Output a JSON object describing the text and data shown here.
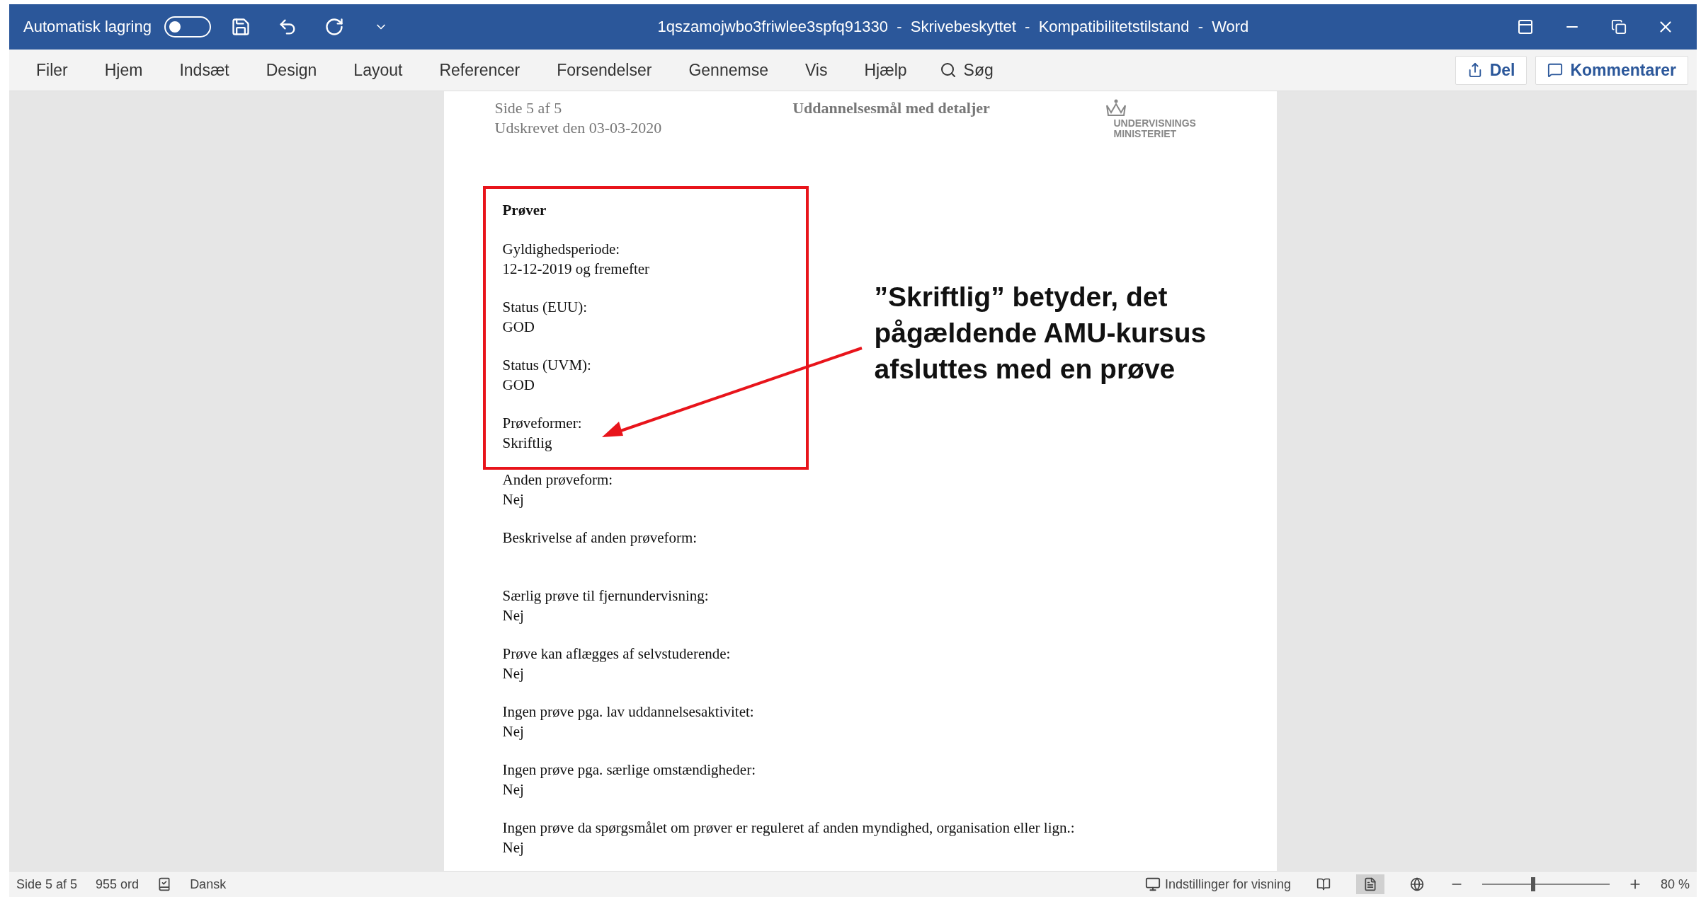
{
  "title_bar": {
    "autosave_label": "Automatisk lagring",
    "autosave_on": false,
    "title": "1qszamojwbo3friwlee3spfq91330  -  Skrivebeskyttet  -  Kompatibilitetstilstand  -  Word"
  },
  "ribbon": {
    "tabs": [
      "Filer",
      "Hjem",
      "Indsæt",
      "Design",
      "Layout",
      "Referencer",
      "Forsendelser",
      "Gennemse",
      "Vis",
      "Hjælp"
    ],
    "search": "Søg",
    "share": "Del",
    "comments": "Kommentarer"
  },
  "page": {
    "header": {
      "page_label": "Side  5  af  5",
      "printed": "Udskrevet den 03-03-2020",
      "heading": "Uddannelsesmål med detaljer",
      "logo_lines": [
        "UNDERVISNINGS",
        "MINISTERIET"
      ]
    },
    "highlight_box": {
      "title": "Prøver",
      "fields": [
        {
          "label": "Gyldighedsperiode:",
          "value": "12-12-2019 og fremefter"
        },
        {
          "label": "Status (EUU):",
          "value": "GOD"
        },
        {
          "label": "Status (UVM):",
          "value": "GOD"
        },
        {
          "label": "Prøveformer:",
          "value": "Skriftlig"
        }
      ]
    },
    "fields": [
      {
        "label": "Anden prøveform:",
        "value": "Nej"
      },
      {
        "label": "Beskrivelse af anden prøveform:"
      },
      {
        "label": "Særlig prøve til fjernundervisning:",
        "value": "Nej"
      },
      {
        "label": "Prøve kan aflægges af selvstuderende:",
        "value": "Nej"
      },
      {
        "label": "Ingen prøve pga. lav uddannelsesaktivitet:",
        "value": "Nej"
      },
      {
        "label": "Ingen prøve pga. særlige omstændigheder:",
        "value": "Nej"
      },
      {
        "label": "Ingen prøve da spørgsmålet om prøver er reguleret af anden myndighed, organisation eller lign.:",
        "value": "Nej"
      }
    ]
  },
  "annotation": {
    "lines": [
      "”Skriftlig” betyder, det",
      "pågældende AMU-kursus",
      "afsluttes med en prøve"
    ]
  },
  "status_bar": {
    "page": "Side 5 af 5",
    "words": "955 ord",
    "language": "Dansk",
    "display_settings": "Indstillinger for visning",
    "views": [
      {
        "kind": "read",
        "selected": false
      },
      {
        "kind": "print",
        "selected": true
      },
      {
        "kind": "web",
        "selected": false
      }
    ],
    "zoom": {
      "level": 0.4,
      "reading": "80 %"
    }
  }
}
